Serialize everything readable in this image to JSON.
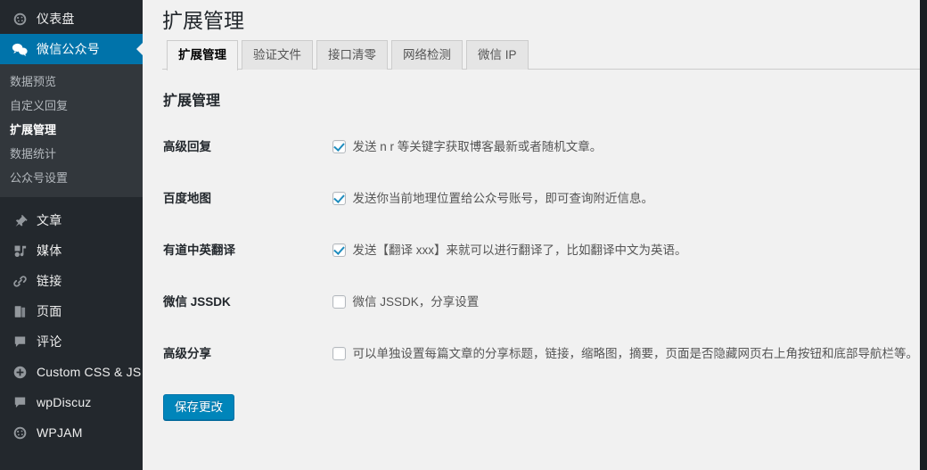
{
  "sidebar": {
    "items": [
      {
        "label": "仪表盘",
        "icon": "dashboard-icon",
        "state": "normal"
      },
      {
        "label": "微信公众号",
        "icon": "wechat-icon",
        "state": "current"
      },
      {
        "label": "文章",
        "icon": "pin-icon",
        "state": "normal"
      },
      {
        "label": "媒体",
        "icon": "media-icon",
        "state": "normal"
      },
      {
        "label": "链接",
        "icon": "link-icon",
        "state": "normal"
      },
      {
        "label": "页面",
        "icon": "page-icon",
        "state": "normal"
      },
      {
        "label": "评论",
        "icon": "comment-icon",
        "state": "normal"
      },
      {
        "label": "Custom CSS & JS",
        "icon": "plus-circle-icon",
        "state": "normal"
      },
      {
        "label": "wpDiscuz",
        "icon": "comment-icon",
        "state": "normal"
      },
      {
        "label": "WPJAM",
        "icon": "dashboard-icon",
        "state": "normal"
      }
    ],
    "submenu": [
      {
        "label": "数据预览",
        "active": false
      },
      {
        "label": "自定义回复",
        "active": false
      },
      {
        "label": "扩展管理",
        "active": true
      },
      {
        "label": "数据统计",
        "active": false
      },
      {
        "label": "公众号设置",
        "active": false
      }
    ]
  },
  "main": {
    "page_title": "扩展管理",
    "section_title": "扩展管理",
    "tabs": [
      {
        "label": "扩展管理",
        "active": true
      },
      {
        "label": "验证文件",
        "active": false
      },
      {
        "label": "接口清零",
        "active": false
      },
      {
        "label": "网络检测",
        "active": false
      },
      {
        "label": "微信 IP",
        "active": false
      }
    ],
    "rows": [
      {
        "label": "高级回复",
        "checked": true,
        "description": "发送 n r 等关键字获取博客最新或者随机文章。"
      },
      {
        "label": "百度地图",
        "checked": true,
        "description": "发送你当前地理位置给公众号账号，即可查询附近信息。"
      },
      {
        "label": "有道中英翻译",
        "checked": true,
        "description": "发送【翻译 xxx】来就可以进行翻译了，比如翻译中文为英语。"
      },
      {
        "label": "微信 JSSDK",
        "checked": false,
        "description": "微信 JSSDK，分享设置"
      },
      {
        "label": "高级分享",
        "checked": false,
        "description": "可以单独设置每篇文章的分享标题，链接，缩略图，摘要，页面是否隐藏网页右上角按钮和底部导航栏等。"
      }
    ],
    "submit_label": "保存更改"
  },
  "colors": {
    "sidebar_bg": "#23282d",
    "submenu_bg": "#32373c",
    "accent": "#0073aa",
    "button_primary": "#0085ba",
    "checkmark": "#1e8cbe",
    "content_bg": "#f1f1f1"
  }
}
